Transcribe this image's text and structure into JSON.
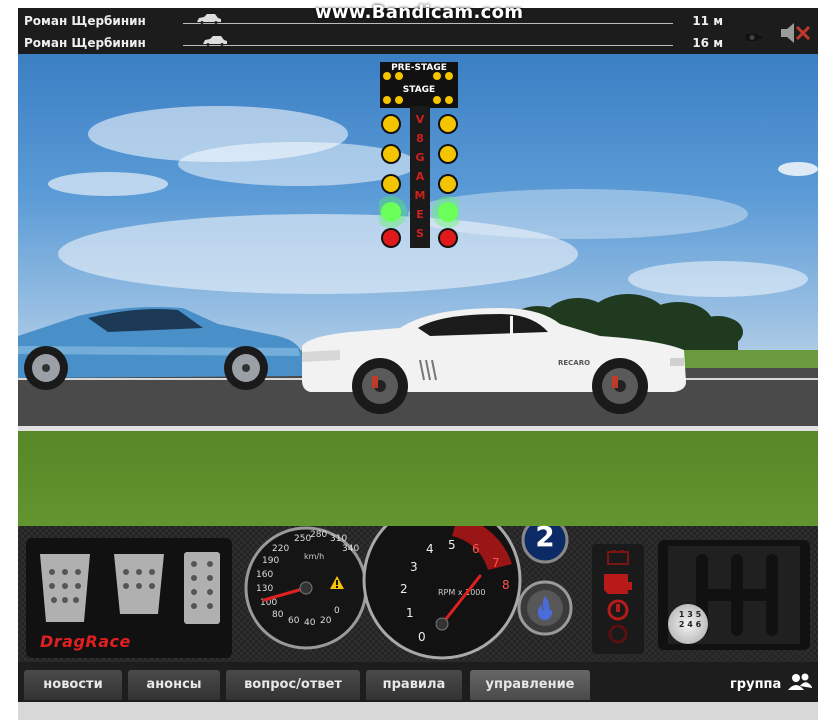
{
  "watermark": "www.Bandicam.com",
  "race": {
    "rows": [
      {
        "name": "Роман Щербинин",
        "distance": "11 м"
      },
      {
        "name": "Роман Щербинин",
        "distance": "16 м"
      }
    ]
  },
  "tree": {
    "prestage_label": "PRE-STAGE",
    "stage_label": "STAGE",
    "brand_letters": [
      "V",
      "8",
      "G",
      "A",
      "M",
      "E",
      "S"
    ]
  },
  "car": {
    "decal": "RECARO"
  },
  "dashboard": {
    "speedo_ticks": [
      "220",
      "250",
      "280",
      "310",
      "340",
      "190",
      "160",
      "130",
      "100",
      "80",
      "60",
      "40",
      "20",
      "0"
    ],
    "speedo_unit": "km/h",
    "tacho_ticks": [
      "0",
      "1",
      "2",
      "3",
      "4",
      "5",
      "6",
      "7",
      "8"
    ],
    "tacho_unit": "RPM x 1000",
    "gear": "2",
    "logo_part1": "Drag",
    "logo_part2": "Race",
    "shifter_digits": [
      "1",
      "3",
      "5",
      "2",
      "4",
      "6"
    ]
  },
  "nav": {
    "tabs": [
      "новости",
      "анонсы",
      "вопрос/ответ",
      "правила",
      "управление"
    ],
    "group_label": "группа"
  },
  "colors": {
    "bg_dark": "#1d1d1d",
    "tab_active": "#555555",
    "needle": "#e02020",
    "green_light": "#4cff4c",
    "amber_light": "#f5c400",
    "red_light": "#e01a1a"
  }
}
